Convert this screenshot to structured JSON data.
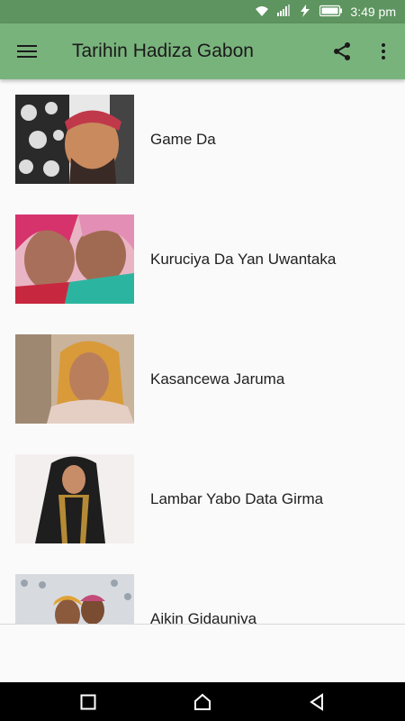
{
  "status_bar": {
    "time": "3:49 pm",
    "icons": [
      "wifi-icon",
      "signal-icon",
      "data-saver-icon",
      "battery-icon"
    ]
  },
  "app_bar": {
    "title": "Tarihin Hadiza Gabon",
    "menu_icon": "hamburger-menu-icon",
    "share_icon": "share-icon",
    "overflow_icon": "more-vert-icon",
    "color": "#79b37c"
  },
  "list": {
    "items": [
      {
        "label": "Game Da"
      },
      {
        "label": "Kuruciya Da Yan Uwantaka"
      },
      {
        "label": "Kasancewa Jaruma"
      },
      {
        "label": "Lambar Yabo Data Girma"
      },
      {
        "label": "Aikin Gidauniya"
      }
    ]
  },
  "nav_bar": {
    "icons": [
      "recent-apps-icon",
      "home-icon",
      "back-icon"
    ]
  }
}
